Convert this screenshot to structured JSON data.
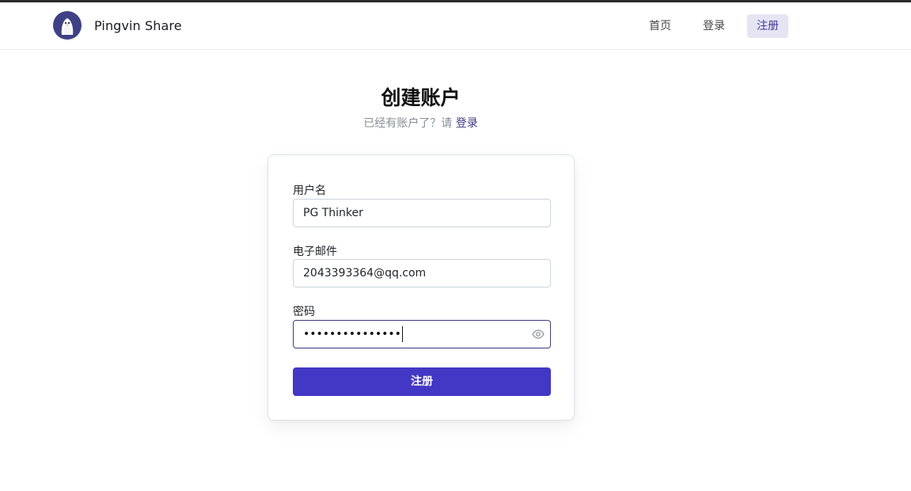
{
  "header": {
    "brand_name": "Pingvin Share",
    "nav": {
      "home": "首页",
      "login": "登录",
      "signup": "注册"
    }
  },
  "main": {
    "title": "创建账户",
    "subtitle_prefix": "已经有账户了？请 ",
    "subtitle_link": "登录"
  },
  "form": {
    "username_label": "用户名",
    "username_value": "PG Thinker",
    "email_label": "电子邮件",
    "email_value": "2043393364@qq.com",
    "password_label": "密码",
    "password_masked": "•••••••••••••••",
    "submit_label": "注册"
  },
  "colors": {
    "accent": "#4338c5",
    "active_nav_bg": "#e5e4f3"
  },
  "icons": {
    "logo": "penguin-logo",
    "password_toggle": "eye-icon"
  }
}
